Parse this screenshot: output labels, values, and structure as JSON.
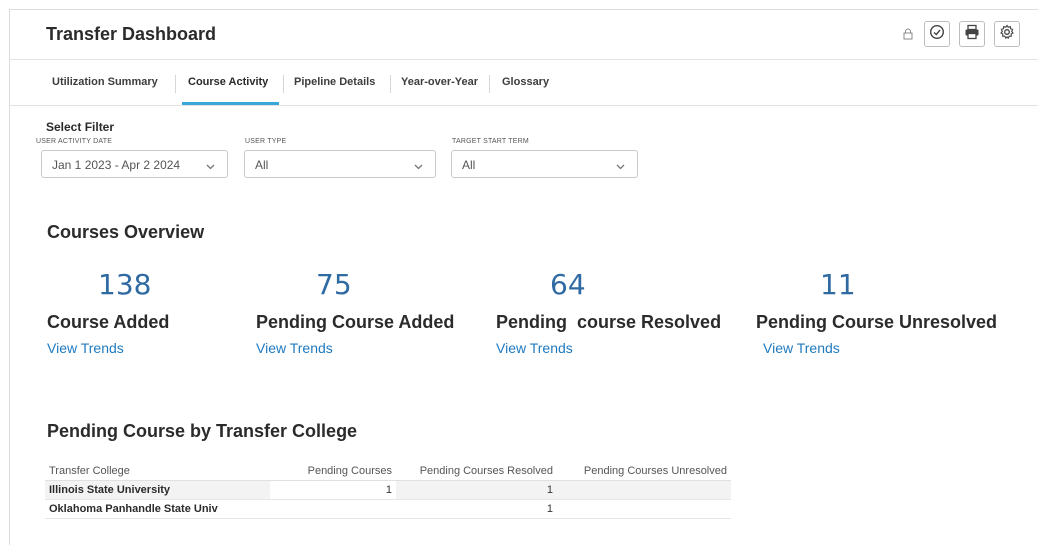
{
  "header": {
    "title": "Transfer Dashboard",
    "icons": [
      "lock-icon",
      "clock-icon",
      "print-icon",
      "gear-icon"
    ]
  },
  "tabs": [
    {
      "label": "Utilization Summary",
      "active": false
    },
    {
      "label": "Course Activity",
      "active": true
    },
    {
      "label": "Pipeline Details",
      "active": false
    },
    {
      "label": "Year-over-Year",
      "active": false
    },
    {
      "label": "Glossary",
      "active": false
    }
  ],
  "filters": {
    "title": "Select Filter",
    "activity_date": {
      "label": "USER ACTIVITY DATE",
      "value": "Jan 1 2023 - Apr 2 2024"
    },
    "user_type": {
      "label": "USER TYPE",
      "value": "All"
    },
    "target_term": {
      "label": "TARGET START TERM",
      "value": "All"
    }
  },
  "overview": {
    "title": "Courses Overview",
    "kpis": [
      {
        "value": "138",
        "label": "Course Added",
        "link": "View Trends"
      },
      {
        "value": "75",
        "label": "Pending Course Added",
        "link": "View Trends"
      },
      {
        "value": "64",
        "label": "Pending  course Resolved",
        "link": "View Trends"
      },
      {
        "value": "11",
        "label": "Pending Course Unresolved",
        "link": "View Trends"
      }
    ]
  },
  "pending_table": {
    "title": "Pending Course by Transfer College",
    "columns": [
      "Transfer College",
      "Pending Courses",
      "Pending Courses Resolved",
      "Pending Courses Unresolved"
    ],
    "rows": [
      [
        "Illinois State University",
        "1",
        "1",
        ""
      ],
      [
        "Oklahoma Panhandle State Univ",
        "",
        "1",
        ""
      ]
    ]
  },
  "colors": {
    "accent": "#3ba7d9",
    "kpi_value": "#2f6aa3",
    "link": "#1f7abf"
  }
}
